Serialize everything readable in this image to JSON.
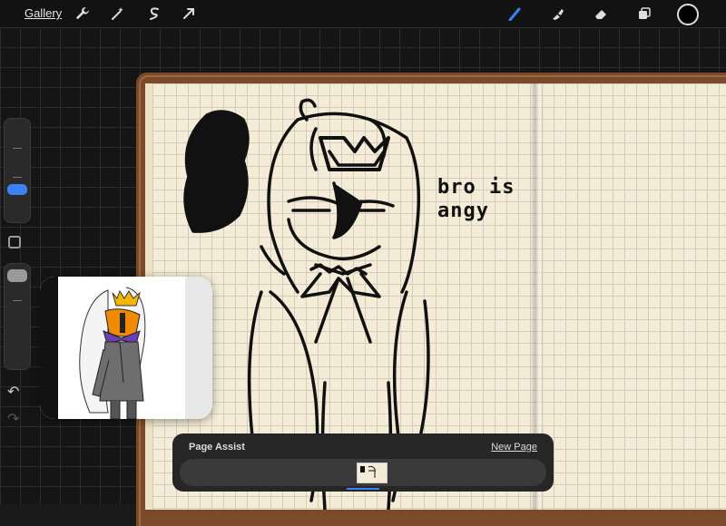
{
  "topbar": {
    "gallery_label": "Gallery",
    "left_tools": [
      {
        "name": "actions-wrench-icon"
      },
      {
        "name": "adjustments-wand-icon"
      },
      {
        "name": "selection-s-icon"
      },
      {
        "name": "transform-arrow-icon"
      }
    ],
    "right_tools": [
      {
        "name": "brush-icon",
        "active": true
      },
      {
        "name": "smudge-icon"
      },
      {
        "name": "eraser-icon"
      },
      {
        "name": "layers-icon"
      }
    ],
    "active_color": "#000000",
    "accent": "#3b82f6"
  },
  "canvas": {
    "handwritten_note": "bro is\nangy"
  },
  "sidebar": {
    "brush_size_thumb_color": "#3b82f6",
    "opacity_thumb_color": "#9a9a9a",
    "undo_glyph": "↶",
    "redo_glyph": "↷"
  },
  "page_assist": {
    "title": "Page Assist",
    "new_page_label": "New Page"
  }
}
